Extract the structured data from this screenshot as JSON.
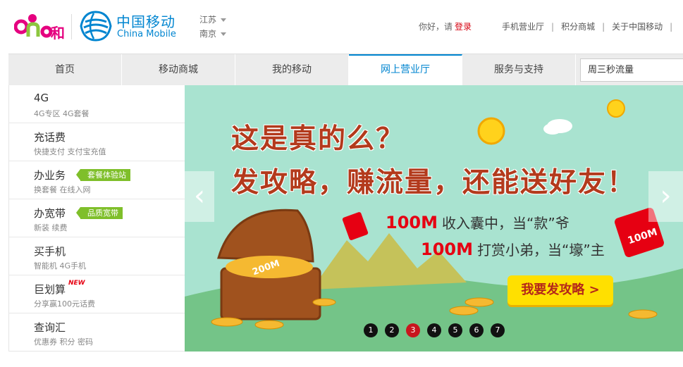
{
  "header": {
    "brand_cn": "中国移动",
    "brand_en": "China Mobile",
    "logo_text": "and和",
    "province": "江苏",
    "city": "南京",
    "greeting": "你好，请",
    "login": "登录",
    "links": [
      "手机营业厅",
      "积分商城",
      "关于中国移动"
    ],
    "separator": "|"
  },
  "nav": {
    "items": [
      "首页",
      "移动商城",
      "我的移动",
      "网上营业厅",
      "服务与支持"
    ],
    "active_index": 3,
    "search_value": "周三秒流量"
  },
  "sidebar": {
    "items": [
      {
        "title": "4G",
        "sub": "4G专区 4G套餐"
      },
      {
        "title": "充话费",
        "sub": "快捷支付 支付宝充值"
      },
      {
        "title": "办业务",
        "sub": "换套餐 在线入网",
        "tag": "套餐体验站"
      },
      {
        "title": "办宽带",
        "sub": "新装 续费",
        "tag": "品质宽带"
      },
      {
        "title": "买手机",
        "sub": "智能机 4G手机"
      },
      {
        "title": "巨划算",
        "sub": "分享赢100元话费",
        "badge": "NEW"
      },
      {
        "title": "查询汇",
        "sub": "优惠券 积分 密码"
      }
    ]
  },
  "banner": {
    "headline1": "这是真的么？",
    "headline2": "发攻略，赚流量，还能送好友！",
    "promo1_amount": "100M",
    "promo1_text": "收入囊中，当“款”爷",
    "promo2_amount": "100M",
    "promo2_text": "打赏小弟，当“壕”主",
    "cta": "我要发攻略 >",
    "chest_label": "200M",
    "envelope_label": "100M",
    "arrow_left": "‹",
    "arrow_right": "›",
    "dots": [
      "1",
      "2",
      "3",
      "4",
      "5",
      "6",
      "7"
    ],
    "active_dot_index": 2
  },
  "colors": {
    "brand_blue": "#0085d0",
    "accent_red": "#d6000f",
    "tag_green": "#7fbf2a",
    "banner_bg": "#a9e3d0",
    "cta_yellow": "#ffe000"
  }
}
